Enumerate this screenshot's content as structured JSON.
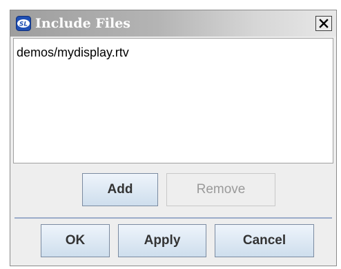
{
  "window": {
    "title": "Include Files",
    "app_icon": "sl-logo-icon",
    "close_icon": "close-x-icon"
  },
  "file_list": {
    "items": [
      "demos/mydisplay.rtv"
    ]
  },
  "list_buttons": {
    "add_label": "Add",
    "remove_label": "Remove",
    "remove_enabled": false
  },
  "dialog_buttons": {
    "ok_label": "OK",
    "apply_label": "Apply",
    "cancel_label": "Cancel"
  },
  "colors": {
    "button_border": "#7a8aa0",
    "separator": "#9aabc9"
  }
}
